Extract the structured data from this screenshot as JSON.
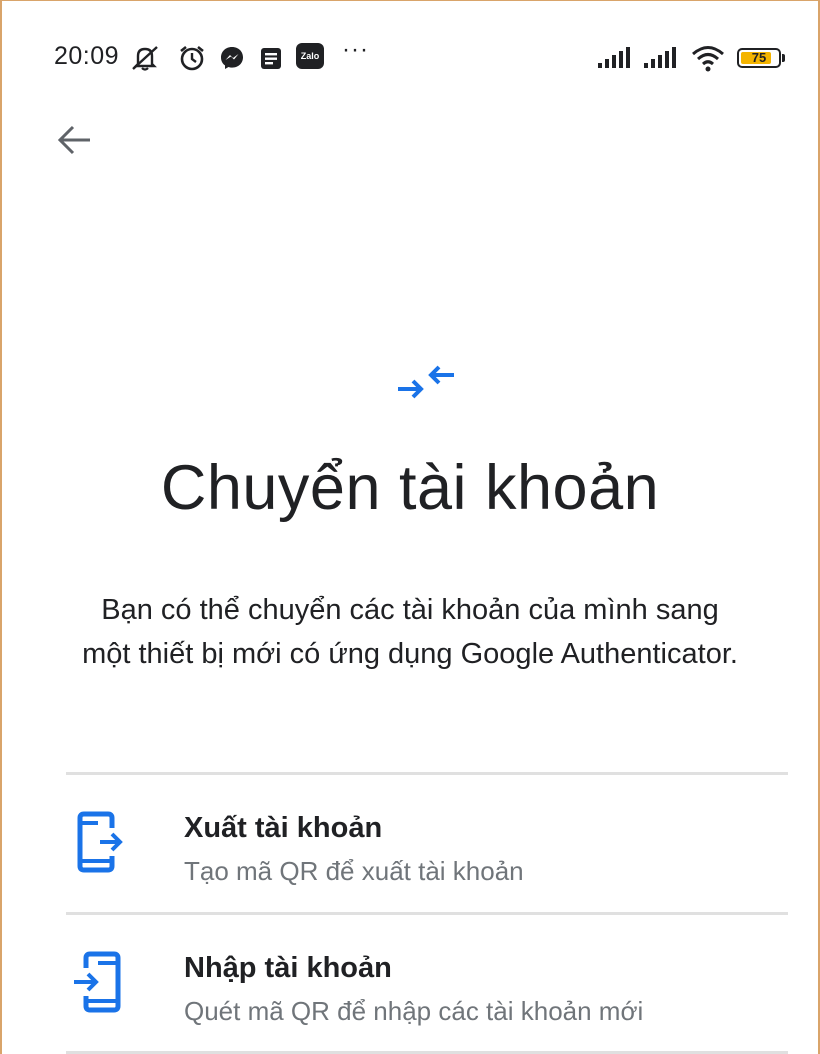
{
  "status_bar": {
    "time": "20:09",
    "zalo_label": "Zalo",
    "more_dots": "···",
    "battery_level": "75",
    "icons": [
      "silent-mode-icon",
      "alarm-icon",
      "messenger-icon",
      "notes-icon",
      "zalo-icon",
      "signal-icon",
      "signal-icon",
      "wifi-icon",
      "battery-icon"
    ]
  },
  "header": {
    "back_icon": "arrow-back-icon"
  },
  "main": {
    "hero_icon": "transfer-arrows-icon",
    "title": "Chuyển tài khoản",
    "description": "Bạn có thể chuyển các tài khoản của mình sang một thiết bị mới có ứng dụng Google Authenticator."
  },
  "options": [
    {
      "icon": "phone-export-icon",
      "title": "Xuất tài khoản",
      "subtitle": "Tạo mã QR để xuất tài khoản"
    },
    {
      "icon": "phone-import-icon",
      "title": "Nhập tài khoản",
      "subtitle": "Quét mã QR để nhập các tài khoản mới"
    }
  ],
  "colors": {
    "accent": "#1a73e8",
    "text_primary": "#202124",
    "text_secondary": "#70757a",
    "divider": "#e0e0e0",
    "battery": "#f4b400"
  }
}
